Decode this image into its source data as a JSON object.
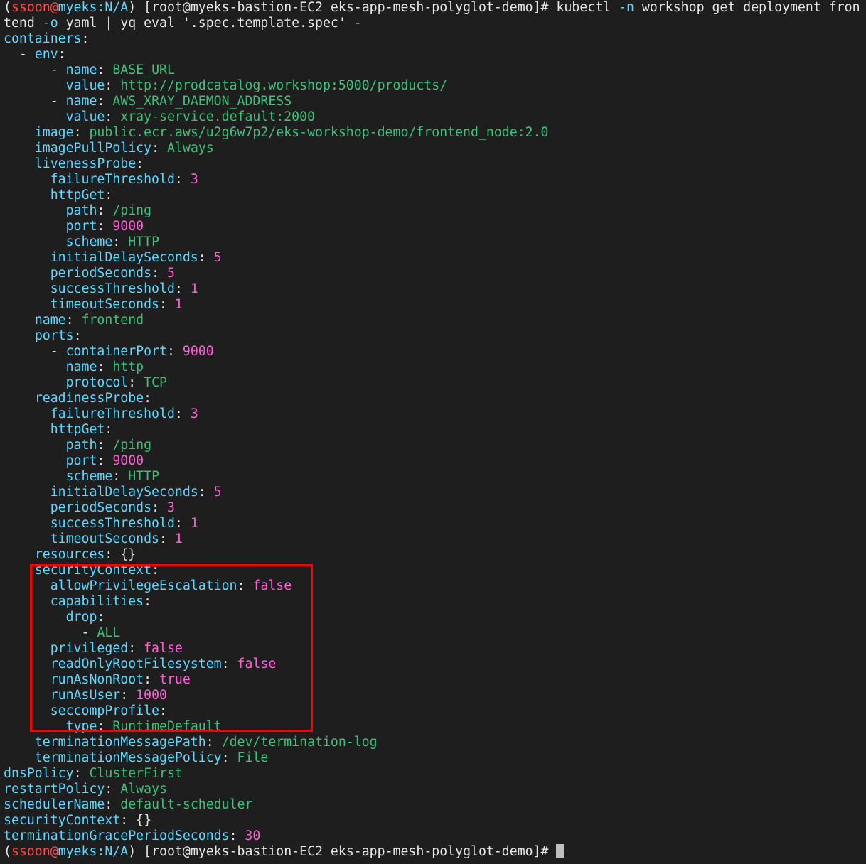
{
  "prompt": {
    "open": "(",
    "user": "ssoon",
    "at": "@",
    "cluster": "myeks",
    "context": ":N/A",
    "close": ")",
    "host": " [root@myeks-bastion-EC2 eks-app-mesh-polyglot-demo]# "
  },
  "command": {
    "line1_a": "kubectl ",
    "flag_n": "-n",
    "line1_b": " workshop get deployment fron",
    "line2_a": "tend ",
    "flag_o": "-o",
    "line2_b": " yaml | yq eval '.spec.template.spec' -"
  },
  "yaml": [
    {
      "indent": "",
      "key": "containers",
      "sep": ":",
      "value": "",
      "type": ""
    },
    {
      "indent": "  ",
      "dash": "- ",
      "key": "env",
      "sep": ":",
      "value": "",
      "type": ""
    },
    {
      "indent": "      ",
      "dash": "- ",
      "key": "name",
      "sep": ": ",
      "value": "BASE_URL",
      "type": "s"
    },
    {
      "indent": "        ",
      "key": "value",
      "sep": ": ",
      "value": "http://prodcatalog.workshop:5000/products/",
      "type": "s"
    },
    {
      "indent": "      ",
      "dash": "- ",
      "key": "name",
      "sep": ": ",
      "value": "AWS_XRAY_DAEMON_ADDRESS",
      "type": "s"
    },
    {
      "indent": "        ",
      "key": "value",
      "sep": ": ",
      "value": "xray-service.default:2000",
      "type": "s"
    },
    {
      "indent": "    ",
      "key": "image",
      "sep": ": ",
      "value": "public.ecr.aws/u2g6w7p2/eks-workshop-demo/frontend_node:2.0",
      "type": "s"
    },
    {
      "indent": "    ",
      "key": "imagePullPolicy",
      "sep": ": ",
      "value": "Always",
      "type": "s"
    },
    {
      "indent": "    ",
      "key": "livenessProbe",
      "sep": ":",
      "value": "",
      "type": ""
    },
    {
      "indent": "      ",
      "key": "failureThreshold",
      "sep": ": ",
      "value": "3",
      "type": "n"
    },
    {
      "indent": "      ",
      "key": "httpGet",
      "sep": ":",
      "value": "",
      "type": ""
    },
    {
      "indent": "        ",
      "key": "path",
      "sep": ": ",
      "value": "/ping",
      "type": "s"
    },
    {
      "indent": "        ",
      "key": "port",
      "sep": ": ",
      "value": "9000",
      "type": "n"
    },
    {
      "indent": "        ",
      "key": "scheme",
      "sep": ": ",
      "value": "HTTP",
      "type": "s"
    },
    {
      "indent": "      ",
      "key": "initialDelaySeconds",
      "sep": ": ",
      "value": "5",
      "type": "n"
    },
    {
      "indent": "      ",
      "key": "periodSeconds",
      "sep": ": ",
      "value": "5",
      "type": "n"
    },
    {
      "indent": "      ",
      "key": "successThreshold",
      "sep": ": ",
      "value": "1",
      "type": "n"
    },
    {
      "indent": "      ",
      "key": "timeoutSeconds",
      "sep": ": ",
      "value": "1",
      "type": "n"
    },
    {
      "indent": "    ",
      "key": "name",
      "sep": ": ",
      "value": "frontend",
      "type": "s"
    },
    {
      "indent": "    ",
      "key": "ports",
      "sep": ":",
      "value": "",
      "type": ""
    },
    {
      "indent": "      ",
      "dash": "- ",
      "key": "containerPort",
      "sep": ": ",
      "value": "9000",
      "type": "n"
    },
    {
      "indent": "        ",
      "key": "name",
      "sep": ": ",
      "value": "http",
      "type": "s"
    },
    {
      "indent": "        ",
      "key": "protocol",
      "sep": ": ",
      "value": "TCP",
      "type": "s"
    },
    {
      "indent": "    ",
      "key": "readinessProbe",
      "sep": ":",
      "value": "",
      "type": ""
    },
    {
      "indent": "      ",
      "key": "failureThreshold",
      "sep": ": ",
      "value": "3",
      "type": "n"
    },
    {
      "indent": "      ",
      "key": "httpGet",
      "sep": ":",
      "value": "",
      "type": ""
    },
    {
      "indent": "        ",
      "key": "path",
      "sep": ": ",
      "value": "/ping",
      "type": "s"
    },
    {
      "indent": "        ",
      "key": "port",
      "sep": ": ",
      "value": "9000",
      "type": "n"
    },
    {
      "indent": "        ",
      "key": "scheme",
      "sep": ": ",
      "value": "HTTP",
      "type": "s"
    },
    {
      "indent": "      ",
      "key": "initialDelaySeconds",
      "sep": ": ",
      "value": "5",
      "type": "n"
    },
    {
      "indent": "      ",
      "key": "periodSeconds",
      "sep": ": ",
      "value": "3",
      "type": "n"
    },
    {
      "indent": "      ",
      "key": "successThreshold",
      "sep": ": ",
      "value": "1",
      "type": "n"
    },
    {
      "indent": "      ",
      "key": "timeoutSeconds",
      "sep": ": ",
      "value": "1",
      "type": "n"
    },
    {
      "indent": "    ",
      "key": "resources",
      "sep": ": ",
      "value": "{}",
      "type": "p"
    },
    {
      "indent": "    ",
      "key": "securityContext",
      "sep": ":",
      "value": "",
      "type": ""
    },
    {
      "indent": "      ",
      "key": "allowPrivilegeEscalation",
      "sep": ": ",
      "value": "false",
      "type": "b"
    },
    {
      "indent": "      ",
      "key": "capabilities",
      "sep": ":",
      "value": "",
      "type": ""
    },
    {
      "indent": "        ",
      "key": "drop",
      "sep": ":",
      "value": "",
      "type": ""
    },
    {
      "indent": "          ",
      "dash": "- ",
      "key": "",
      "sep": "",
      "value": "ALL",
      "type": "s"
    },
    {
      "indent": "      ",
      "key": "privileged",
      "sep": ": ",
      "value": "false",
      "type": "b"
    },
    {
      "indent": "      ",
      "key": "readOnlyRootFilesystem",
      "sep": ": ",
      "value": "false",
      "type": "b"
    },
    {
      "indent": "      ",
      "key": "runAsNonRoot",
      "sep": ": ",
      "value": "true",
      "type": "b"
    },
    {
      "indent": "      ",
      "key": "runAsUser",
      "sep": ": ",
      "value": "1000",
      "type": "n"
    },
    {
      "indent": "      ",
      "key": "seccompProfile",
      "sep": ":",
      "value": "",
      "type": ""
    },
    {
      "indent": "        ",
      "key": "type",
      "sep": ": ",
      "value": "RuntimeDefault",
      "type": "s"
    },
    {
      "indent": "    ",
      "key": "terminationMessagePath",
      "sep": ": ",
      "value": "/dev/termination-log",
      "type": "s"
    },
    {
      "indent": "    ",
      "key": "terminationMessagePolicy",
      "sep": ": ",
      "value": "File",
      "type": "s"
    },
    {
      "indent": "",
      "key": "dnsPolicy",
      "sep": ": ",
      "value": "ClusterFirst",
      "type": "s"
    },
    {
      "indent": "",
      "key": "restartPolicy",
      "sep": ": ",
      "value": "Always",
      "type": "s"
    },
    {
      "indent": "",
      "key": "schedulerName",
      "sep": ": ",
      "value": "default-scheduler",
      "type": "s"
    },
    {
      "indent": "",
      "key": "securityContext",
      "sep": ": ",
      "value": "{}",
      "type": "p"
    },
    {
      "indent": "",
      "key": "terminationGracePeriodSeconds",
      "sep": ": ",
      "value": "30",
      "type": "n"
    }
  ],
  "colors": {
    "background": "#1e1e1e",
    "key": "#5fd7ff",
    "string": "#3dc27a",
    "number": "#ff5fd7",
    "prompt_user": "#ff4a4a",
    "highlight_border": "#ff0000"
  }
}
